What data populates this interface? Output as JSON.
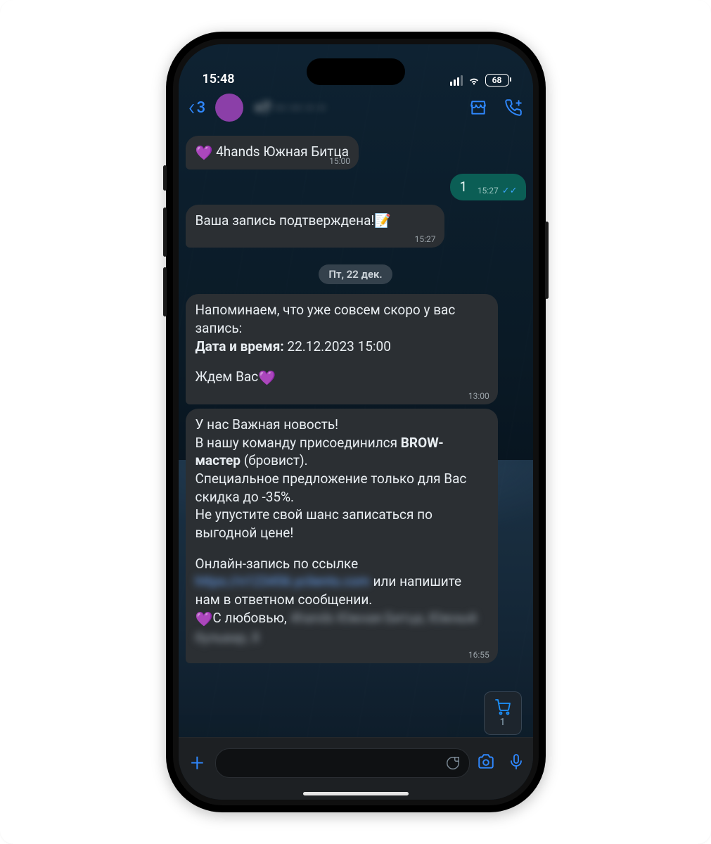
{
  "status": {
    "time": "15:48",
    "battery": "68"
  },
  "nav": {
    "back_count": "3",
    "contact_name_blurred": "+7 ··· ··· ·· ··"
  },
  "messages": {
    "m0": {
      "heart": "💜",
      "text": "4hands Южная Битца",
      "time": "15:00"
    },
    "m1": {
      "text": "1",
      "time": "15:27"
    },
    "m2": {
      "text": "Ваша запись подтверждена!",
      "memo": "📝",
      "time": "15:27"
    },
    "date_sep": "Пт, 22 дек.",
    "m3": {
      "l1": "Напоминаем, что уже совсем скоро у вас запись:",
      "l2a": "Дата и время:",
      "l2b": " 22.12.2023 15:00",
      "l3": "Ждем Вас",
      "time": "13:00"
    },
    "m4": {
      "l1": "У нас Важная новость!",
      "l2": "В нашу команду присоединился ",
      "l2b": "BROW-мастер",
      "l2c": " (бровист).",
      "l3": "Специальное предложение только для Вас скидка до -35%.",
      "l4": "Не упустите свой шанс записаться по выгодной цене!",
      "l5": "Онлайн-запись по ссылке ",
      "link_blur": "https://n123456.yclients.com",
      "l5b": " или напишите нам в ответном сообщении.",
      "l6": "С любовью, ",
      "sig_blur": "4hands Южная Битца, Южный бульвар, 8",
      "time": "16:55"
    }
  },
  "cart": {
    "count": "1"
  }
}
